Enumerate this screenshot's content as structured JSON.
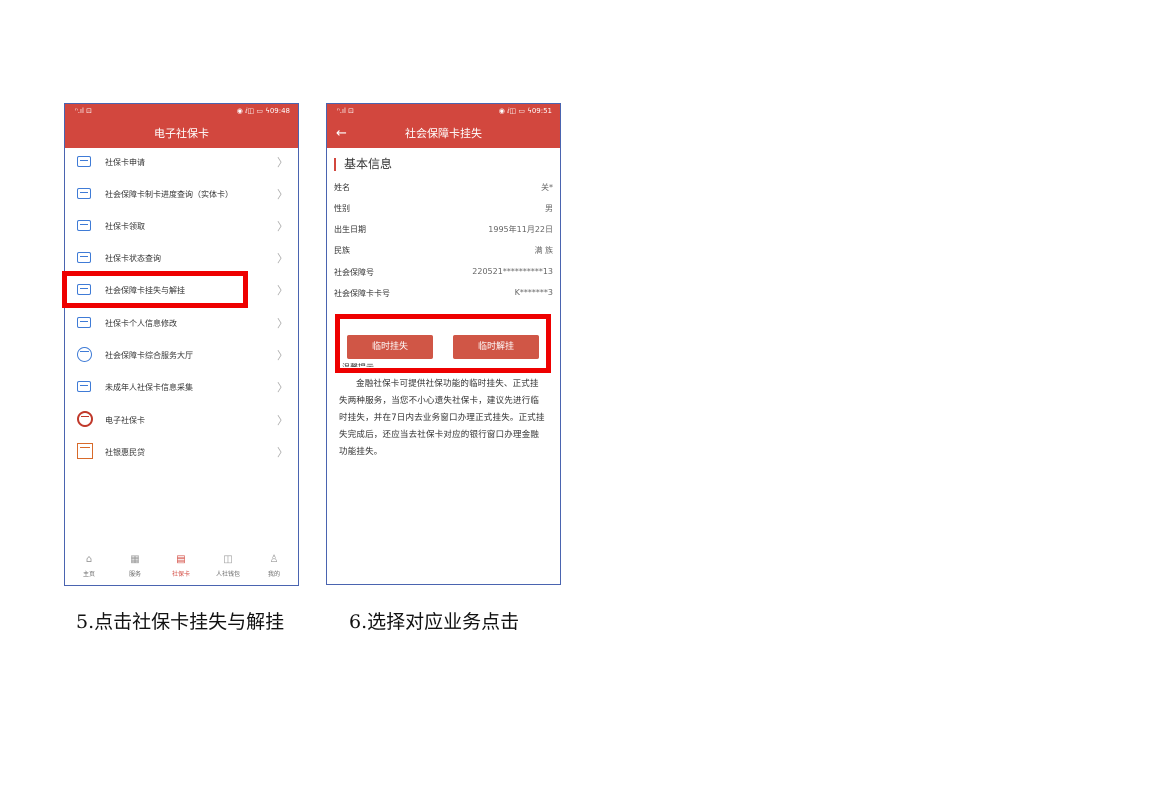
{
  "phone1": {
    "status_left": "ⁿ.ıl ⊡",
    "status_right": "◉ ⅈ◫ ▭ ϟ09:48",
    "title": "电子社保卡",
    "menu": [
      {
        "label": "社保卡申请",
        "icon": "card-icon"
      },
      {
        "label": "社会保障卡制卡进度查询（实体卡）",
        "icon": "card-progress-icon"
      },
      {
        "label": "社保卡领取",
        "icon": "card-pickup-icon"
      },
      {
        "label": "社保卡状态查询",
        "icon": "card-status-icon"
      },
      {
        "label": "社会保障卡挂失与解挂",
        "icon": "card-lock-icon"
      },
      {
        "label": "社保卡个人信息修改",
        "icon": "card-edit-icon"
      },
      {
        "label": "社会保障卡综合服务大厅",
        "icon": "service-hall-icon"
      },
      {
        "label": "未成年人社保卡信息采集",
        "icon": "minor-card-icon"
      },
      {
        "label": "电子社保卡",
        "icon": "e-card-seal-icon"
      },
      {
        "label": "社银惠民贷",
        "icon": "loan-icon"
      }
    ],
    "tabs": [
      {
        "label": "主页",
        "icon": "home-icon",
        "glyph": "⌂"
      },
      {
        "label": "服务",
        "icon": "grid-icon",
        "glyph": "▦"
      },
      {
        "label": "社保卡",
        "icon": "card-tab-icon",
        "glyph": "▤"
      },
      {
        "label": "人社钱包",
        "icon": "wallet-icon",
        "glyph": "◫"
      },
      {
        "label": "我的",
        "icon": "user-icon",
        "glyph": "♙"
      }
    ]
  },
  "phone2": {
    "status_left": "ⁿ.ıl ⊡",
    "status_right": "◉ ⅈ◫ ▭ ϟ09:51",
    "title": "社会保障卡挂失",
    "back": "←",
    "section_title": "基本信息",
    "rows": [
      {
        "key": "姓名",
        "value": "关*"
      },
      {
        "key": "性别",
        "value": "男"
      },
      {
        "key": "出生日期",
        "value": "1995年11月22日"
      },
      {
        "key": "民族",
        "value": "满 族"
      },
      {
        "key": "社会保障号",
        "value": "220521**********13"
      },
      {
        "key": "社会保障卡卡号",
        "value": "K*******3"
      }
    ],
    "btn_lose": "临时挂失",
    "btn_unlock": "临时解挂",
    "tip_title": "温馨提示",
    "tip_body": "金融社保卡可提供社保功能的临时挂失、正式挂失两种服务，当您不小心遗失社保卡，建议先进行临时挂失，并在7日内去业务窗口办理正式挂失。正式挂失完成后，还应当去社保卡对应的银行窗口办理金融功能挂失。"
  },
  "captions": {
    "step5": "5.点击社保卡挂失与解挂",
    "step6": "6.选择对应业务点击"
  },
  "colors": {
    "brand": "#d2473e",
    "highlight": "#ee0000",
    "button": "#d05646",
    "icon_blue": "#3f7bd6"
  }
}
